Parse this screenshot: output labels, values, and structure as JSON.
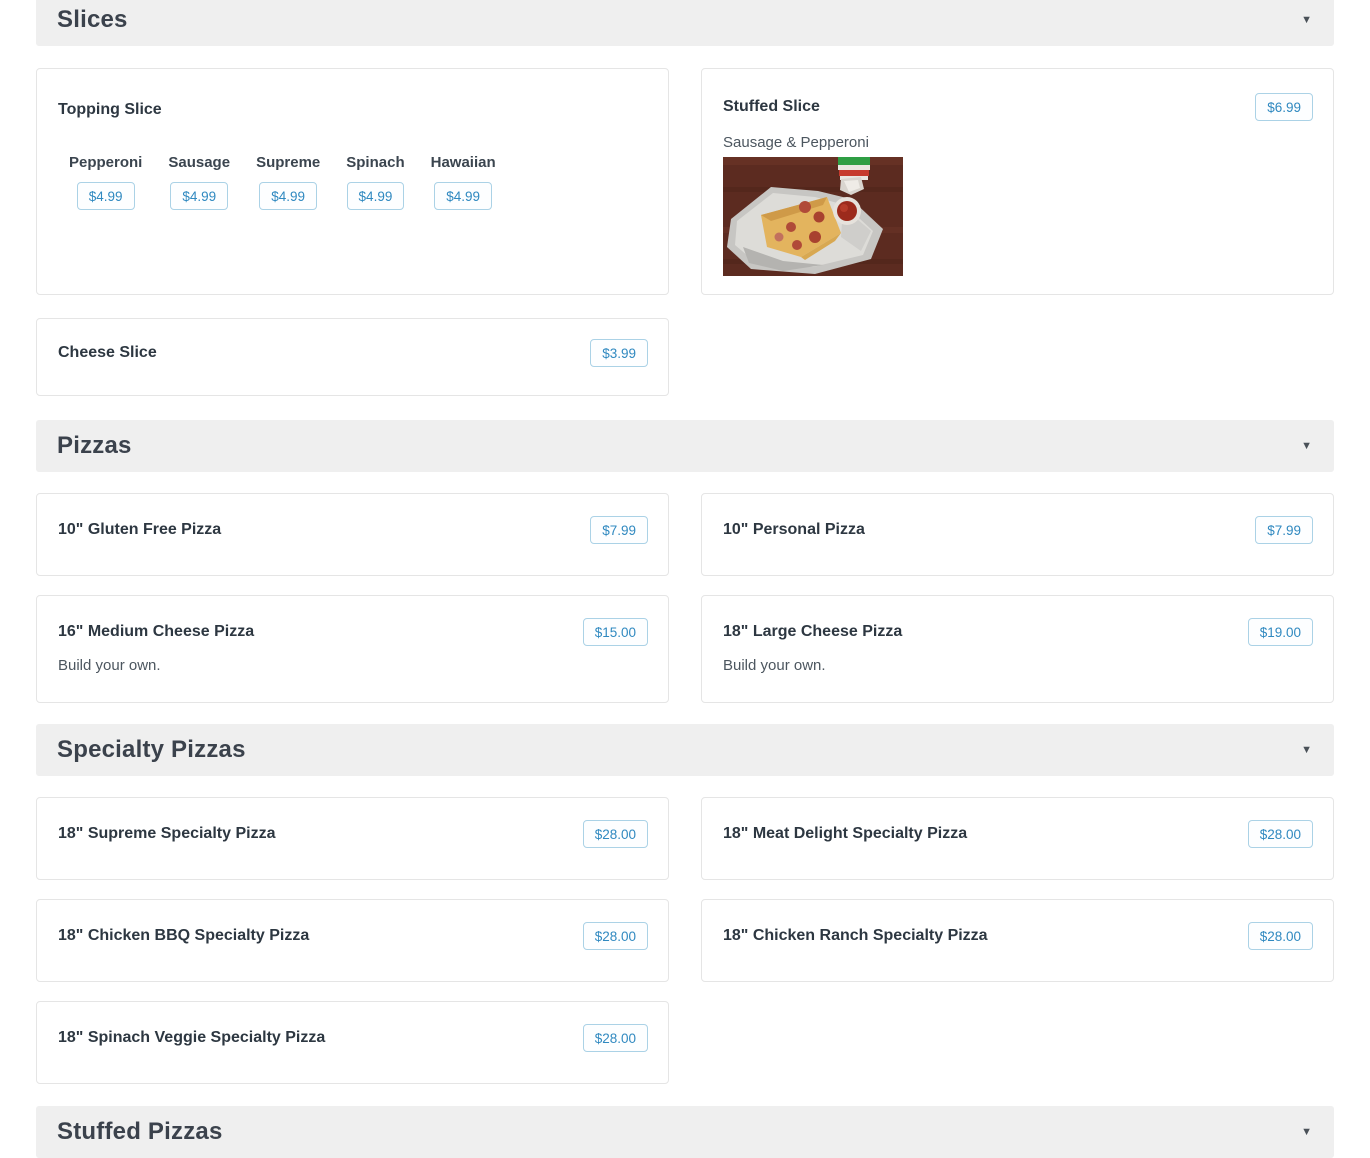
{
  "colors": {
    "section_bar_bg": "#efefef",
    "section_title": "#3b424c",
    "card_border": "#e5e5e5",
    "item_title": "#2d3741",
    "description": "#4c565f",
    "price_text": "#3089c0",
    "price_border": "#abd2e6"
  },
  "icons": {
    "chevron_down": "▼"
  },
  "sections": {
    "slices": {
      "title": "Slices",
      "topping_slice": {
        "name": "Topping Slice",
        "variants": [
          {
            "label": "Pepperoni",
            "price": "$4.99"
          },
          {
            "label": "Sausage",
            "price": "$4.99"
          },
          {
            "label": "Supreme",
            "price": "$4.99"
          },
          {
            "label": "Spinach",
            "price": "$4.99"
          },
          {
            "label": "Hawaiian",
            "price": "$4.99"
          }
        ]
      },
      "stuffed_slice": {
        "name": "Stuffed Slice",
        "price": "$6.99",
        "description": "Sausage & Pepperoni",
        "photo": "stuffed-slice-photo"
      },
      "cheese_slice": {
        "name": "Cheese Slice",
        "price": "$3.99"
      }
    },
    "pizzas": {
      "title": "Pizzas",
      "items": [
        {
          "name": "10\" Gluten Free Pizza",
          "price": "$7.99",
          "description": ""
        },
        {
          "name": "10\" Personal Pizza",
          "price": "$7.99",
          "description": ""
        },
        {
          "name": "16\" Medium Cheese Pizza",
          "price": "$15.00",
          "description": "Build your own."
        },
        {
          "name": "18\" Large Cheese Pizza",
          "price": "$19.00",
          "description": "Build your own."
        }
      ]
    },
    "specialty_pizzas": {
      "title": "Specialty Pizzas",
      "items": [
        {
          "name": "18\" Supreme Specialty Pizza",
          "price": "$28.00"
        },
        {
          "name": "18\" Meat Delight Specialty Pizza",
          "price": "$28.00"
        },
        {
          "name": "18\" Chicken BBQ Specialty Pizza",
          "price": "$28.00"
        },
        {
          "name": "18\" Chicken Ranch Specialty Pizza",
          "price": "$28.00"
        },
        {
          "name": "18\" Spinach Veggie Specialty Pizza",
          "price": "$28.00"
        }
      ]
    },
    "stuffed_pizzas": {
      "title": "Stuffed Pizzas"
    }
  }
}
